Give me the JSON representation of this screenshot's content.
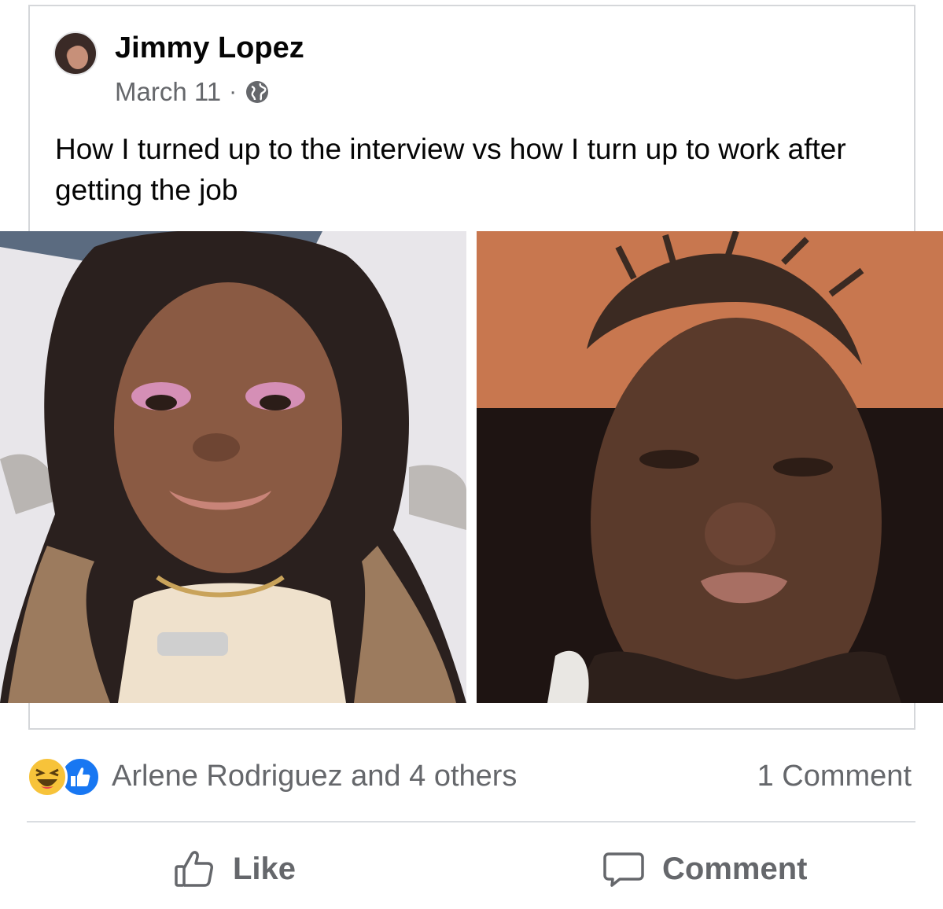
{
  "post": {
    "author": "Jimmy Lopez",
    "date": "March 11",
    "separator": "·",
    "audience_icon": "globe-icon",
    "caption": "How I turned up to the interview vs how I turn up to work after getting the job"
  },
  "engagement": {
    "reaction_icons": [
      "haha-reaction-icon",
      "like-reaction-icon"
    ],
    "reactors": "Arlene Rodriguez and 4 others",
    "comment_count": "1 Comment"
  },
  "actions": {
    "like_label": "Like",
    "comment_label": "Comment"
  },
  "colors": {
    "like_blue": "#1877f2",
    "haha_yellow": "#f7c33a",
    "secondary_text": "#65676b"
  }
}
